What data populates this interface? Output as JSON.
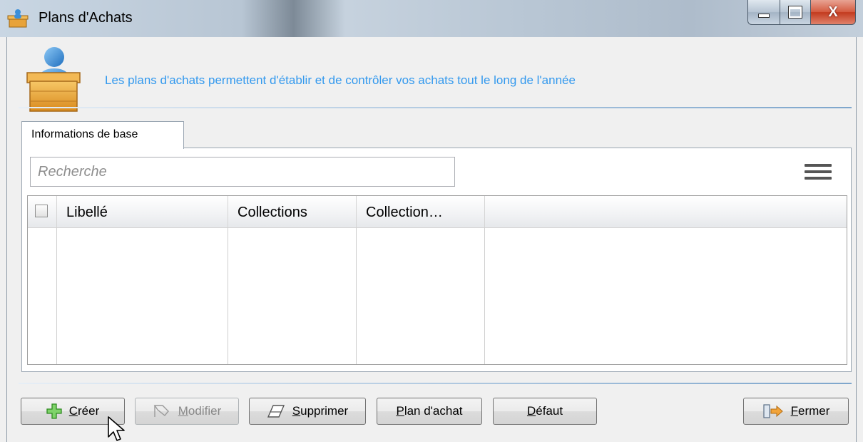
{
  "window": {
    "title": "Plans d'Achats",
    "controls": {
      "minimize": "minimize",
      "maximize": "maximize",
      "close": "X"
    }
  },
  "header": {
    "description": "Les plans d'achats permettent d'établir et de contrôler vos achats tout le long de l'année",
    "accent_color": "#3399ee"
  },
  "tabs": [
    {
      "label": "Informations de base",
      "active": true
    }
  ],
  "search": {
    "placeholder": "Recherche",
    "value": ""
  },
  "grid": {
    "columns": [
      "Libellé",
      "Collections",
      "Collection…"
    ],
    "rows": []
  },
  "buttons": {
    "create": {
      "mnemonic": "C",
      "rest": "réer",
      "enabled": true,
      "icon": "plus-icon"
    },
    "modify": {
      "mnemonic": "M",
      "rest": "odifier",
      "enabled": false,
      "icon": "edit-icon"
    },
    "delete": {
      "mnemonic": "S",
      "rest": "upprimer",
      "enabled": true,
      "icon": "eraser-icon"
    },
    "plan": {
      "mnemonic": "P",
      "rest": "lan d'achat",
      "enabled": true
    },
    "default": {
      "mnemonic": "D",
      "rest": "éfaut",
      "enabled": true
    },
    "close": {
      "mnemonic": "F",
      "rest": "ermer",
      "enabled": true,
      "icon": "exit-icon"
    }
  }
}
